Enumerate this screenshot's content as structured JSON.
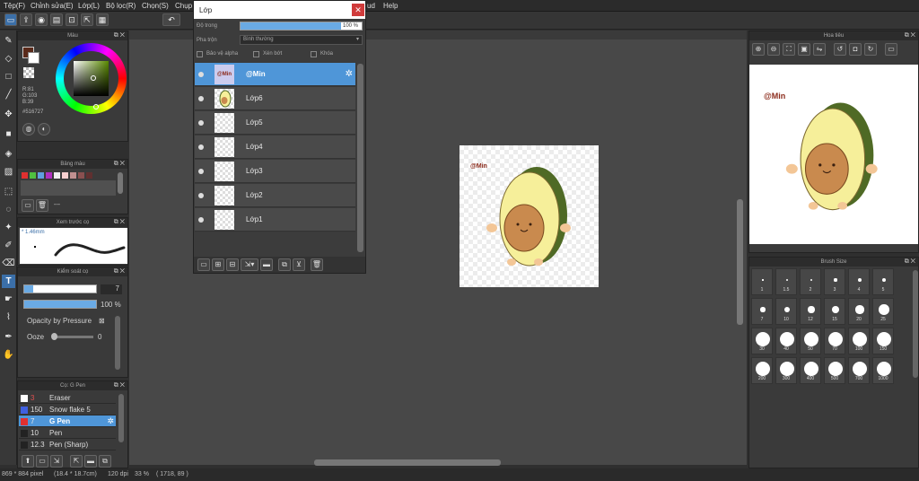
{
  "menu": [
    "Tệp(F)",
    "Chỉnh sửa(E)",
    "Lớp(L)",
    "Bộ lọc(R)",
    "Chọn(S)",
    "Chụp",
    "ud",
    "Help"
  ],
  "color_panel": {
    "title": "Màu",
    "rgb": [
      "R:81",
      "G:103",
      "B:39"
    ],
    "hex": "#516727",
    "primary_color": "#5a2a1a",
    "secondary_color": "#ffffff"
  },
  "palette_panel": {
    "title": "Bảng màu",
    "swatches": [
      "#e03030",
      "#50c040",
      "#60a0e0",
      "#b030c0",
      "#f0f0f0",
      "#f8d0d0",
      "#c09090",
      "#8a5050",
      "#603030"
    ],
    "ellipsis": "---"
  },
  "brush_preview": {
    "title": "Xem trước cọ",
    "size": "* 1.46mm"
  },
  "brush_control": {
    "title": "Kiểm soát cọ",
    "size_value": "7",
    "opacity_value": "100 %",
    "opacity_pressure_label": "Opacity by Pressure",
    "ooze_label": "Ooze",
    "ooze_value": "0"
  },
  "brush_list": {
    "title": "Cọ: G Pen",
    "items": [
      {
        "size": "3",
        "name": "Eraser",
        "color": "#ffffff",
        "selected": false
      },
      {
        "size": "150",
        "name": "Snow flake 5",
        "color": "#4060e0",
        "selected": false
      },
      {
        "size": "7",
        "name": "G Pen",
        "color": "#e03030",
        "selected": true
      },
      {
        "size": "10",
        "name": "Pen",
        "color": "#222222",
        "selected": false
      },
      {
        "size": "12.3",
        "name": "Pen (Sharp)",
        "color": "#222222",
        "selected": false
      }
    ]
  },
  "layer_panel": {
    "title": "Lớp",
    "opacity_label": "Độ trong",
    "opacity_value": "100 %",
    "blend_label": "Pha trộn",
    "blend_value": "Bình thường",
    "protect_alpha": "Bảo vệ alpha",
    "clipping": "Xén bớt",
    "lock": "Khóa",
    "layers": [
      "@Min",
      "Lớp6",
      "Lớp5",
      "Lớp4",
      "Lớp3",
      "Lớp2",
      "Lớp1"
    ]
  },
  "navigator": {
    "title": "Hoa tiêu"
  },
  "brush_size": {
    "title": "Brush Size",
    "sizes": [
      "1",
      "1.5",
      "2",
      "3",
      "4",
      "5",
      "7",
      "10",
      "12",
      "15",
      "20",
      "25",
      "30",
      "40",
      "50",
      "70",
      "100",
      "150",
      "200",
      "300",
      "400",
      "500",
      "700",
      "1000"
    ]
  },
  "canvas_text": "@Min",
  "status": {
    "size": "869 * 884 pixel",
    "dims": "(18.4 * 18.7cm)",
    "dpi": "120 dpi",
    "zoom": "33 %",
    "coords": "( 1718, 89 )"
  }
}
